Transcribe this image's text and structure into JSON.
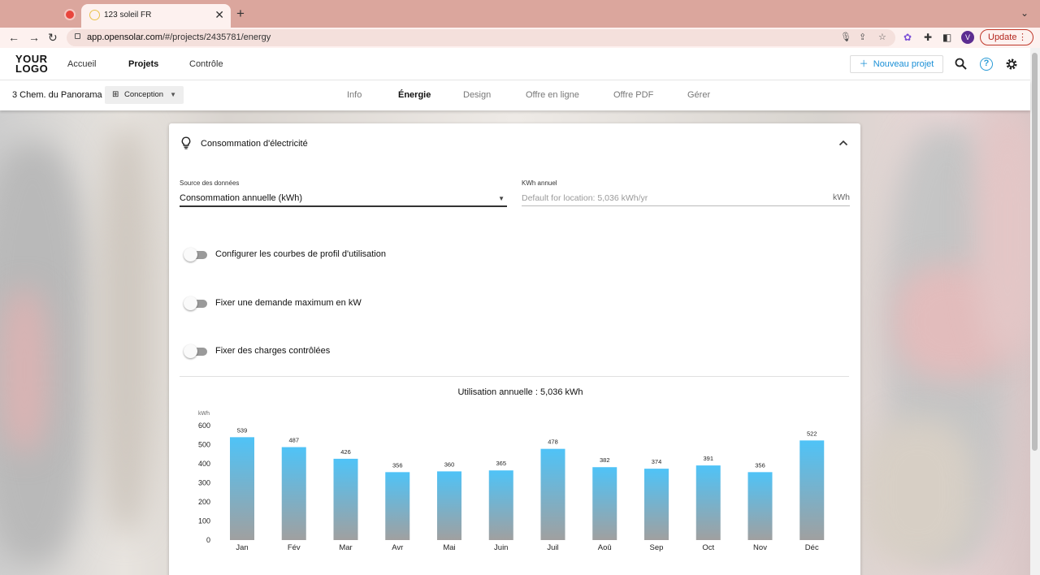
{
  "browser": {
    "tab_title": "123 soleil FR",
    "url_host": "app.opensolar.com",
    "url_path": "/#/projects/2435781/energy",
    "profile_initial": "V",
    "update_label": "Update"
  },
  "header": {
    "logo_line1": "YOUR",
    "logo_line2": "LOGO",
    "nav": [
      "Accueil",
      "Projets",
      "Contrôle"
    ],
    "new_project_label": "Nouveau projet"
  },
  "project": {
    "address": "3 Chem. du Panorama",
    "stage": "Conception",
    "tabs": [
      "Info",
      "Énergie",
      "Design",
      "Offre en ligne",
      "Offre PDF",
      "Gérer"
    ],
    "active_tab": "Énergie"
  },
  "card": {
    "title": "Consommation d'électricité",
    "source_label": "Source des données",
    "source_value": "Consommation annuelle (kWh)",
    "kwh_label": "KWh annuel",
    "kwh_placeholder": "Default for location: 5,036 kWh/yr",
    "kwh_unit": "kWh",
    "toggles": [
      {
        "label": "Configurer les courbes de profil d'utilisation",
        "on": false
      },
      {
        "label": "Fixer une demande maximum en kW",
        "on": false
      },
      {
        "label": "Fixer des charges contrôlées",
        "on": false
      }
    ]
  },
  "chart_data": {
    "type": "bar",
    "title": "Utilisation annuelle : 5,036 kWh",
    "ylabel": "kWh",
    "ylim": [
      0,
      600
    ],
    "yticks": [
      0,
      100,
      200,
      300,
      400,
      500,
      600
    ],
    "categories": [
      "Jan",
      "Fév",
      "Mar",
      "Avr",
      "Mai",
      "Juin",
      "Juil",
      "Aoû",
      "Sep",
      "Oct",
      "Nov",
      "Déc"
    ],
    "values": [
      539,
      487,
      426,
      356,
      360,
      365,
      478,
      382,
      374,
      391,
      356,
      522
    ],
    "bar_color_top": "#4fc3f7",
    "bar_color_bottom": "#a0a0a0",
    "grid": false,
    "legend": "none"
  }
}
